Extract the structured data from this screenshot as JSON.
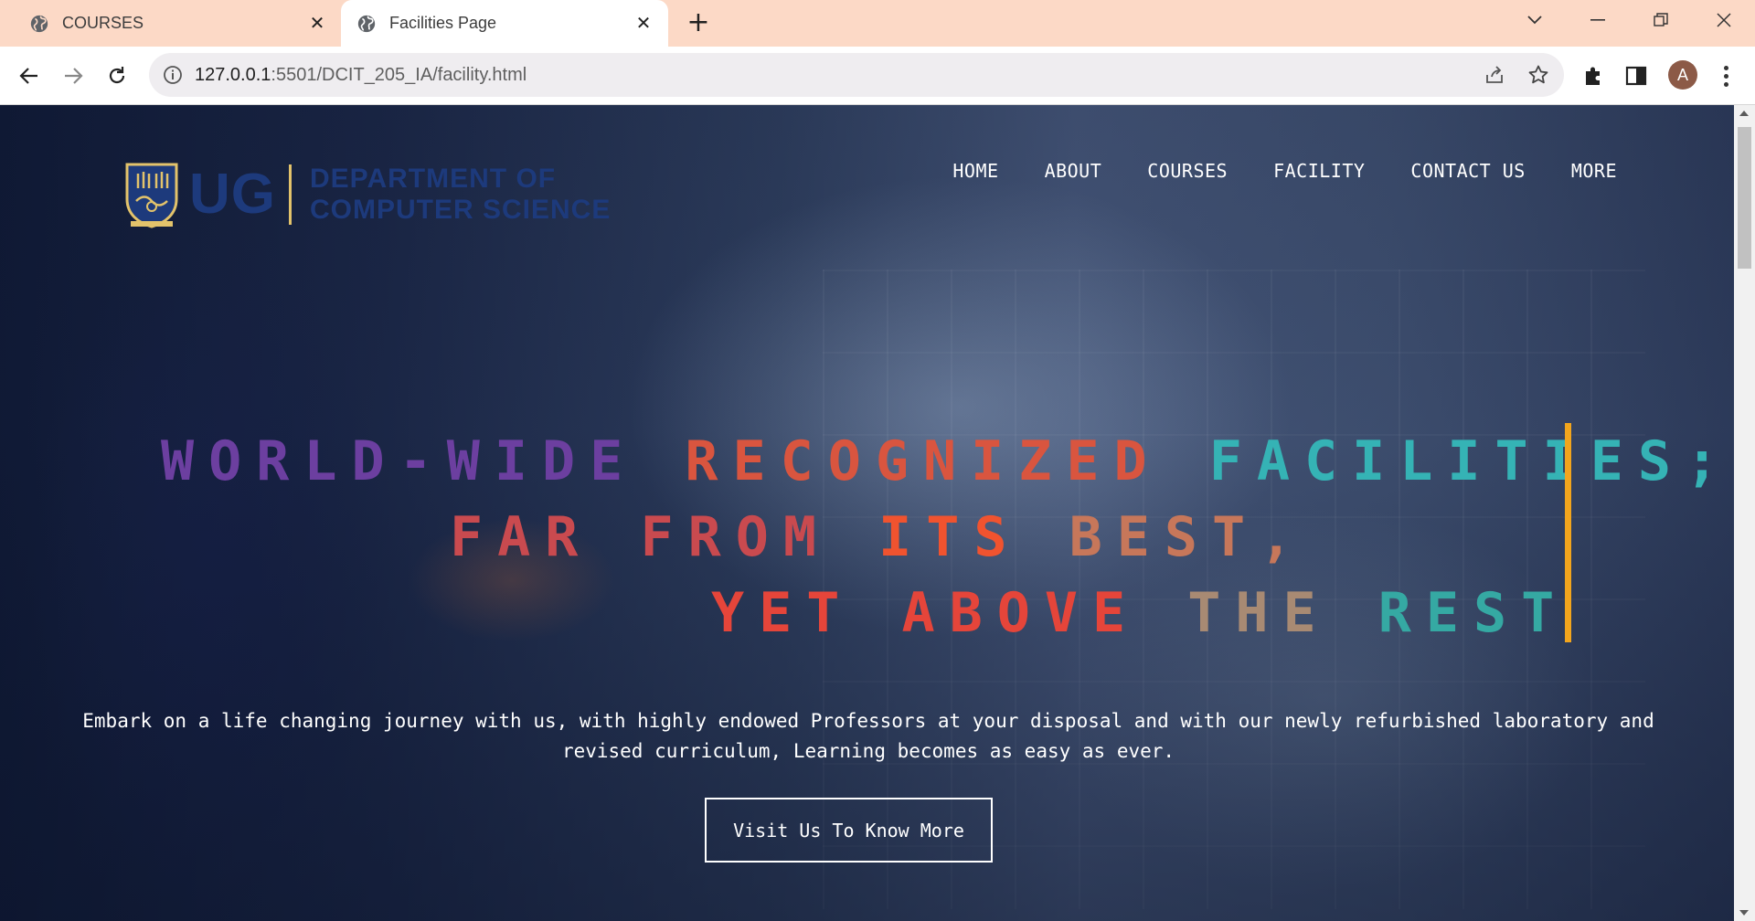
{
  "browser": {
    "tabs": [
      {
        "title": "COURSES",
        "icon": "globe-icon",
        "active": false
      },
      {
        "title": "Facilities Page",
        "icon": "globe-icon",
        "active": true
      }
    ],
    "address": {
      "host": "127.0.0.1",
      "rest": ":5501/DCIT_205_IA/facility.html"
    },
    "profile_initial": "A"
  },
  "site": {
    "logo": {
      "mark": "UG",
      "dept_line1": "DEPARTMENT OF",
      "dept_line2": "COMPUTER SCIENCE"
    },
    "nav": [
      "HOME",
      "ABOUT",
      "COURSES",
      "FACILITY",
      "CONTACT US",
      "MORE"
    ],
    "hero": {
      "line1": [
        {
          "text": "WORLD-WIDE",
          "color": "#6c3fa0"
        },
        {
          "text": "RECOGNIZED",
          "color": "#d9553f"
        },
        {
          "text": "FACILITIES;",
          "color": "#35b3b5"
        }
      ],
      "line2": [
        {
          "text": "FAR FROM",
          "color": "#c94a4f"
        },
        {
          "text": "ITS",
          "color": "#f0532f"
        },
        {
          "text": "BEST,",
          "color": "#c7775a"
        }
      ],
      "line3": [
        {
          "text": "YET ABOVE",
          "color": "#e5453a"
        },
        {
          "text": "THE",
          "color": "#a88a73"
        },
        {
          "text": "REST",
          "color": "#35a9a3"
        }
      ],
      "cursor_color": "#f2a51d"
    },
    "lead": "Embark on a life changing journey with us, with highly endowed Professors at your disposal and with our newly refurbished laboratory and revised curriculum, Learning becomes as easy as ever.",
    "cta_label": "Visit Us To Know More"
  }
}
